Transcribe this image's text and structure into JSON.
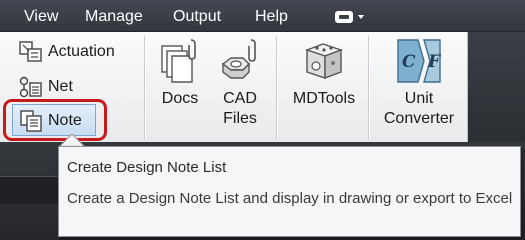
{
  "menu": {
    "items": [
      "View",
      "Manage",
      "Output",
      "Help"
    ]
  },
  "ribbon": {
    "small_buttons": {
      "actuation": "Actuation",
      "net": "Net",
      "note": "Note"
    },
    "large_buttons": {
      "docs": "Docs",
      "cad_files": "CAD Files",
      "mdtools": "MDTools",
      "unit_converter": "Unit Converter"
    },
    "unit_converter_icon": {
      "left_letter": "C",
      "right_letter": "F"
    }
  },
  "tooltip": {
    "title": "Create Design Note List",
    "description": "Create a Design Note List and display in drawing or export to Excel"
  },
  "colors": {
    "menu_bg": "#3b3f46",
    "ribbon_bg": "#f3f4f5",
    "highlight_border": "#c41a1d",
    "tooltip_bg": "#f5f6f7"
  }
}
